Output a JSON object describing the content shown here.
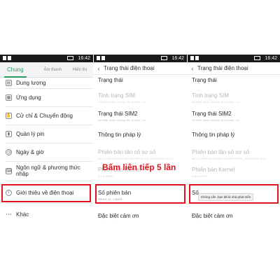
{
  "status": {
    "time": "16:42"
  },
  "panel1": {
    "tabs": [
      {
        "label": "Chung"
      },
      {
        "label": "Âm thanh"
      },
      {
        "label": "Hiển thị"
      }
    ],
    "items": [
      {
        "label": "Dung lượng"
      },
      {
        "label": "Ứng dụng"
      },
      {
        "label": "Cử chỉ & Chuyển động"
      },
      {
        "label": "Quản lý pin"
      },
      {
        "label": "Ngày & giờ"
      },
      {
        "label": "Ngôn ngữ & phương thức nhập"
      },
      {
        "label": "Giới thiệu về điện thoại"
      },
      {
        "label": "Khác"
      }
    ]
  },
  "panel2": {
    "title": "Trạng thái điện thoại",
    "rows": [
      {
        "label": "Trạng thái",
        "sub": ""
      },
      {
        "label": "Tình trạng SIM",
        "sub": "Số điện thoại, cường độ tín hiệu, v.v."
      },
      {
        "label": "Trạng thái SIM2",
        "sub": "Số điện thoại, cường độ tín hiệu, v.v."
      },
      {
        "label": "Thông tin pháp lý",
        "sub": ""
      },
      {
        "label": "Phiên bản tần số sơ số",
        "sub": "MOLY WR8 W1315 MD WG MP V6 P5, 2013/12/20 18:27"
      },
      {
        "label": "Phiên bản Kernel",
        "sub": "3.4.5-00067"
      },
      {
        "label": "Số phiên bản",
        "sub": "R8018_11_140911"
      },
      {
        "label": "Đặc biệt cảm ơn",
        "sub": ""
      }
    ]
  },
  "panel3": {
    "title": "Trạng thái điện thoại",
    "rows": [
      {
        "label": "Trạng thái",
        "sub": ""
      },
      {
        "label": "Tình trạng SIM",
        "sub": "Số điện thoại, cường độ tín hiệu, v.v."
      },
      {
        "label": "Trạng thái SIM2",
        "sub": "Số điện thoại, cường độ tín hiệu, v.v."
      },
      {
        "label": "Thông tin pháp lý",
        "sub": ""
      },
      {
        "label": "Phiên bản tần số sơ số",
        "sub": "MOLY WR8 W1315 MD WG MP V6 P5, 2013/12/20 18:27"
      },
      {
        "label": "Phiên bản Kernel",
        "sub": "3.4.5-00067"
      },
      {
        "label": "Số",
        "sub": ""
      },
      {
        "label": "Đặc biệt cảm ơn",
        "sub": ""
      }
    ],
    "toast": "Không cần ,bạn đã là nhà phát triển"
  },
  "annotation": {
    "label": "Bấm liên tiếp 5 lần"
  },
  "colors": {
    "accent": "#2a9a5a",
    "highlight": "#e0141e"
  }
}
